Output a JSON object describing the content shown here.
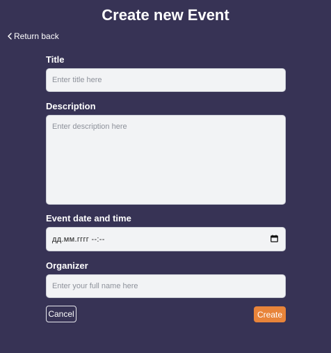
{
  "page": {
    "title": "Create new Event",
    "return_label": "Return back"
  },
  "form": {
    "title_label": "Title",
    "title_placeholder": "Enter title here",
    "description_label": "Description",
    "description_placeholder": "Enter description here",
    "datetime_label": "Event date and time",
    "datetime_value": "дд.мм.гггг --:--",
    "organizer_label": "Organizer",
    "organizer_placeholder": "Enter your full name here"
  },
  "actions": {
    "cancel_label": "Cancel",
    "create_label": "Create"
  },
  "colors": {
    "background": "#373355",
    "accent": "#e8843a"
  },
  "icons": {
    "return": "chevron-left-icon",
    "datetime": "calendar-icon"
  }
}
